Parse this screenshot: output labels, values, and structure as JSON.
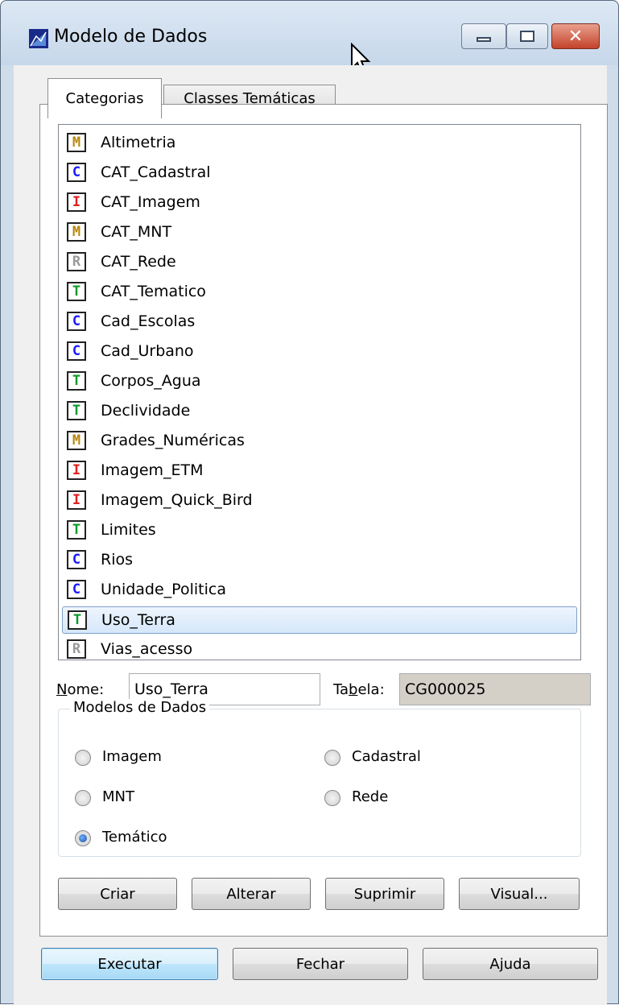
{
  "window": {
    "title": "Modelo de Dados",
    "colors": {
      "titlebar": "#c6d7ea",
      "selection": "#d5e7fb",
      "close": "#c4422a"
    }
  },
  "tabs": [
    {
      "label": "Categorias",
      "active": true
    },
    {
      "label": "Classes Temáticas",
      "active": false
    }
  ],
  "categories": [
    {
      "badge": "M",
      "color": "#b8860b",
      "name": "Altimetria"
    },
    {
      "badge": "C",
      "color": "#1a1aff",
      "name": "CAT_Cadastral"
    },
    {
      "badge": "I",
      "color": "#e02020",
      "name": "CAT_Imagem"
    },
    {
      "badge": "M",
      "color": "#b8860b",
      "name": "CAT_MNT"
    },
    {
      "badge": "R",
      "color": "#999999",
      "name": "CAT_Rede"
    },
    {
      "badge": "T",
      "color": "#0a9a2a",
      "name": "CAT_Tematico"
    },
    {
      "badge": "C",
      "color": "#1a1aff",
      "name": "Cad_Escolas"
    },
    {
      "badge": "C",
      "color": "#1a1aff",
      "name": "Cad_Urbano"
    },
    {
      "badge": "T",
      "color": "#0a9a2a",
      "name": "Corpos_Agua"
    },
    {
      "badge": "T",
      "color": "#0a9a2a",
      "name": "Declividade"
    },
    {
      "badge": "M",
      "color": "#b8860b",
      "name": "Grades_Numéricas"
    },
    {
      "badge": "I",
      "color": "#e02020",
      "name": "Imagem_ETM"
    },
    {
      "badge": "I",
      "color": "#e02020",
      "name": "Imagem_Quick_Bird"
    },
    {
      "badge": "T",
      "color": "#0a9a2a",
      "name": "Limites"
    },
    {
      "badge": "C",
      "color": "#1a1aff",
      "name": "Rios"
    },
    {
      "badge": "C",
      "color": "#1a1aff",
      "name": "Unidade_Politica"
    },
    {
      "badge": "T",
      "color": "#0a9a2a",
      "name": "Uso_Terra",
      "selected": true
    },
    {
      "badge": "R",
      "color": "#999999",
      "name": "Vias_acesso"
    }
  ],
  "form": {
    "nome_label": "Nome:",
    "nome_value": "Uso_Terra",
    "tabela_label": "Tabela:",
    "tabela_value": "CG000025"
  },
  "models": {
    "title": "Modelos de Dados",
    "options": [
      {
        "label": "Imagem",
        "checked": false
      },
      {
        "label": "Cadastral",
        "checked": false
      },
      {
        "label": "MNT",
        "checked": false
      },
      {
        "label": "Rede",
        "checked": false
      },
      {
        "label": "Temático",
        "checked": true
      }
    ]
  },
  "actions": {
    "criar": "Criar",
    "alterar": "Alterar",
    "suprimir": "Suprimir",
    "visual": "Visual..."
  },
  "footer": {
    "executar": "Executar",
    "fechar": "Fechar",
    "ajuda": "Ajuda"
  }
}
